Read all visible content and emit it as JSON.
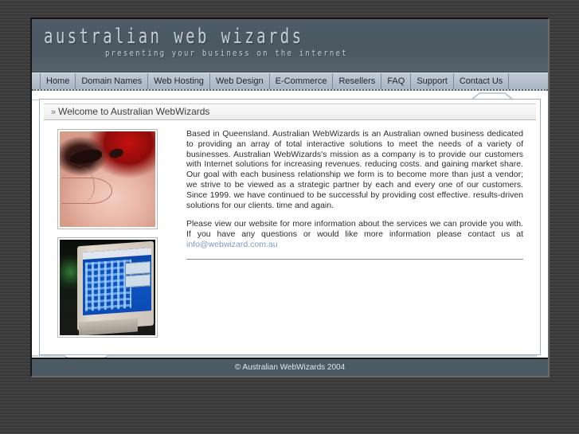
{
  "header": {
    "logo": "australian web wizards",
    "tagline": "presenting your business on the internet"
  },
  "nav": {
    "items": [
      {
        "label": "Home"
      },
      {
        "label": "Domain Names"
      },
      {
        "label": "Web Hosting"
      },
      {
        "label": "Web Design"
      },
      {
        "label": "E-Commerce"
      },
      {
        "label": "Resellers"
      },
      {
        "label": "FAQ"
      },
      {
        "label": "Support"
      },
      {
        "label": "Contact Us"
      }
    ]
  },
  "panel": {
    "chevron": "»",
    "title": "Welcome to Australian WebWizards"
  },
  "images": [
    {
      "alt": "abstract-pink-red-illustration"
    },
    {
      "alt": "crt-monitor-blue-screen-photo"
    }
  ],
  "content": {
    "paragraph1": "Based in Queensland. Australian WebWizards is an Australian owned business dedicated to providing an array of total interactive solutions to meet the needs of a variety of businesses. Australian WebWizards's mission as a company is to provide our customers with Internet solutions for increasing revenues. reducing costs. and gaining market share. Our goal with each business relationship we form is to become more than just a vendor; we strive to be viewed as a strategic partner by each and every one of our customers. Since 1999. we have continued to be successful by providing cost effective. results-driven solutions for our clients. time and again.",
    "paragraph2_before": "Please view our website for more information about the services we can provide you with. If you have any questions or would like more information please contact us at ",
    "email": "info@webwizard.com.au"
  },
  "footer": {
    "copyright": "© Australian WebWizards 2004"
  },
  "colors": {
    "masthead": "#4e5c66",
    "nav_bar": "#b4c0cb",
    "link": "#7b9bc4",
    "page_background": "#3b3b3b"
  }
}
